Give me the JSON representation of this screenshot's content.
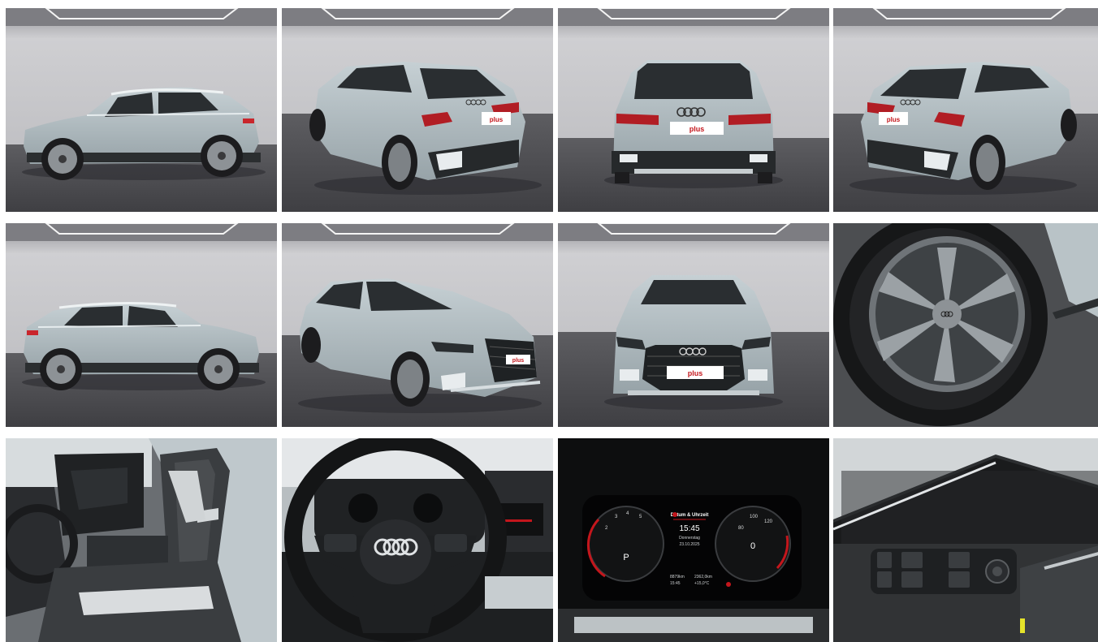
{
  "gallery": {
    "photos": [
      {
        "name": "side-left",
        "alt": "Audi A3 side view left"
      },
      {
        "name": "rear-three-quarter-left",
        "alt": "Audi A3 rear three-quarter left"
      },
      {
        "name": "rear",
        "alt": "Audi A3 rear view"
      },
      {
        "name": "rear-three-quarter-right",
        "alt": "Audi A3 rear three-quarter right"
      },
      {
        "name": "side-right",
        "alt": "Audi A3 side view right"
      },
      {
        "name": "front-three-quarter-left",
        "alt": "Audi A3 front three-quarter left"
      },
      {
        "name": "front",
        "alt": "Audi A3 front view"
      },
      {
        "name": "wheel",
        "alt": "Audi A3 alloy wheel"
      },
      {
        "name": "interior-seats",
        "alt": "Audi A3 front seats"
      },
      {
        "name": "steering-wheel",
        "alt": "Audi A3 steering wheel"
      },
      {
        "name": "instrument-cluster",
        "alt": "Audi A3 virtual cockpit"
      },
      {
        "name": "door-panel",
        "alt": "Audi A3 door panel switches"
      }
    ]
  },
  "plate": {
    "text": "plus"
  },
  "cluster": {
    "menu_title": "Datum & Uhrzeit",
    "time": "15:45",
    "day": "Donnerstag",
    "date": "23.10.2025",
    "gear": "P",
    "right_center": "0",
    "odo_left": "8879km",
    "odo_right": "2362,0km",
    "temp": "+15,0°C",
    "small_left": "15:45"
  },
  "colors": {
    "car_body": "#a9b4b9",
    "studio_wall": "#c9c9cc",
    "studio_floor": "#4a4a4e"
  }
}
